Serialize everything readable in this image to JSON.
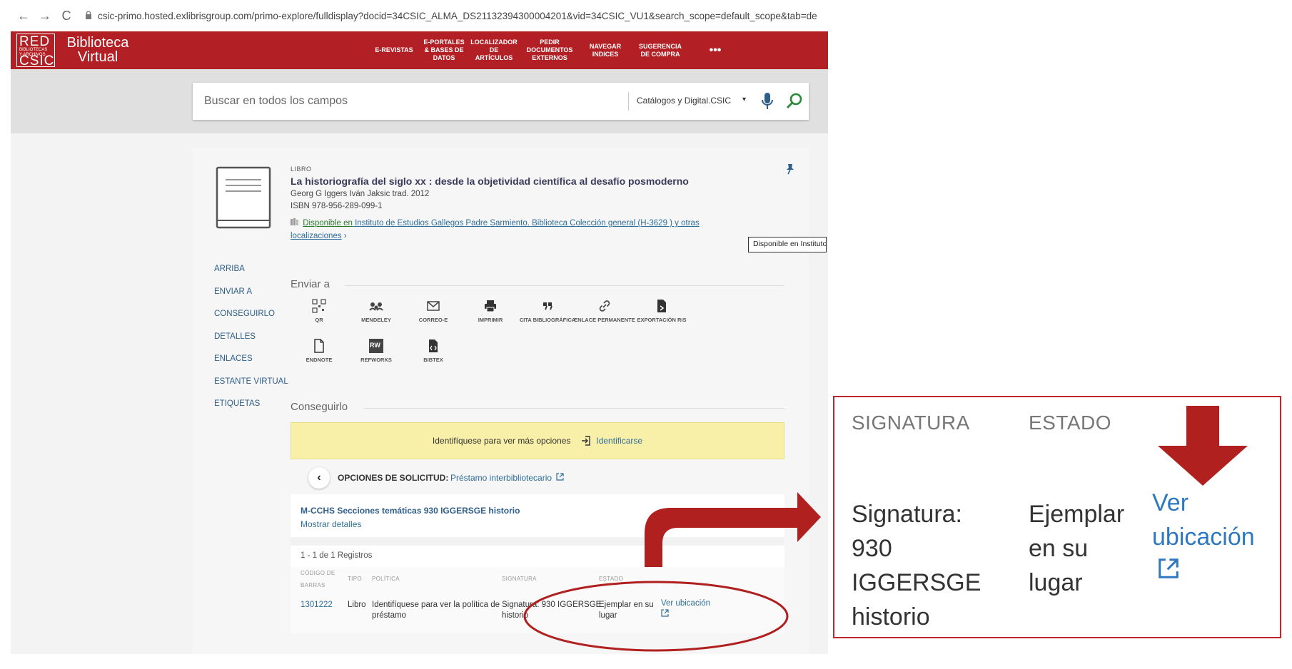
{
  "browser": {
    "back": "←",
    "forward": "→",
    "reload": "C",
    "url": "csic-primo.hosted.exlibrisgroup.com/primo-explore/fulldisplay?docid=34CSIC_ALMA_DS21132394300004201&vid=34CSIC_VU1&search_scope=default_scope&tab=de"
  },
  "header": {
    "logo_red": "RED",
    "logo_small_1": "BIBLIOTECAS",
    "logo_small_2": "Y ARCHIVOS",
    "logo_csic": "CSIC",
    "title_line1": "Biblioteca",
    "title_line2": "Virtual",
    "menu": [
      {
        "label": "E-REVISTAS"
      },
      {
        "label": "E-PORTALES & BASES DE DATOS"
      },
      {
        "label": "LOCALIZADOR DE ARTÍCULOS"
      },
      {
        "label": "PEDIR DOCUMENTOS EXTERNOS"
      },
      {
        "label": "NAVEGAR INDICES"
      },
      {
        "label": "SUGERENCIA DE COMPRA"
      }
    ],
    "more": "•••"
  },
  "search": {
    "placeholder": "Buscar en todos los campos",
    "scope": "Catálogos y Digital.CSIC",
    "scope_caret": "▾"
  },
  "record": {
    "type": "LIBRO",
    "title": "La historiografía del siglo xx : desde la objetividad científica al desafío posmoderno",
    "author": "Georg G Iggers Iván Jaksic trad. 2012",
    "isbn": "ISBN 978-956-289-099-1",
    "avail_status": "Disponible en",
    "avail_location": " Instituto de Estudios Gallegos Padre Sarmiento. Biblioteca  Colección general (H-3629 ) y otras",
    "avail_more": "localizaciones",
    "avail_chevron": " ›",
    "tooltip": "Disponible en Instituto"
  },
  "left_nav": [
    {
      "label": "ARRIBA"
    },
    {
      "label": "ENVIAR A"
    },
    {
      "label": "CONSEGUIRLO"
    },
    {
      "label": "DETALLES"
    },
    {
      "label": "ENLACES"
    },
    {
      "label": "ESTANTE VIRTUAL"
    },
    {
      "label": "ETIQUETAS"
    }
  ],
  "send_to": {
    "title": "Enviar a",
    "actions": [
      {
        "label": "QR",
        "icon": "qr-icon"
      },
      {
        "label": "MENDELEY",
        "icon": "mendeley-icon"
      },
      {
        "label": "CORREO-E",
        "icon": "email-icon"
      },
      {
        "label": "IMPRIMIR",
        "icon": "print-icon"
      },
      {
        "label": "CITA BIBLIOGRÁFICA",
        "icon": "quote-icon"
      },
      {
        "label": "ENLACE PERMANENTE",
        "icon": "link-icon"
      },
      {
        "label": "EXPORTACIÓN RIS",
        "icon": "file-export-icon"
      },
      {
        "label": "ENDNOTE",
        "icon": "file-icon"
      },
      {
        "label": "REFWORKS",
        "icon": "refworks-icon"
      },
      {
        "label": "BIBTEX",
        "icon": "file-code-icon"
      }
    ],
    "refworks_badge": "RW"
  },
  "get_it": {
    "title": "Conseguirlo",
    "login_text": "Identifíquese para ver más opciones",
    "login_link": "Identificarse",
    "request_label": "OPCIONES DE SOLICITUD:",
    "request_link": "Préstamo interbibliotecario",
    "location": "M-CCHS  Secciones temáticas  930 IGGERSGE historio",
    "details_link": "Mostrar detalles",
    "records": "1 - 1 de 1 Registros",
    "table": {
      "headers": {
        "barcode_1": "CÓDIGO DE",
        "barcode_2": "BARRAS",
        "type": "TIPO",
        "policy": "POLÍTICA",
        "signature": "SIGNATURA",
        "status": "ESTADO"
      },
      "row": {
        "barcode": "1301222",
        "type": "Libro",
        "policy_1": "Identifíquese para ver la política de",
        "policy_2": "préstamo",
        "signature_1": "Signatura: 930 IGGERSGE",
        "signature_2": "historio",
        "status_1": "Ejemplar en su",
        "status_2": "lugar",
        "location_link": "Ver ubicación"
      }
    }
  },
  "zoom": {
    "head_signature": "SIGNATURA",
    "head_status": "ESTADO",
    "sig_1": "Signatura:",
    "sig_2": "930",
    "sig_3": "IGGERSGE",
    "sig_4": "historio",
    "status_1": "Ejemplar",
    "status_2": "en su",
    "status_3": "lugar",
    "link_1": "Ver",
    "link_2": "ubicación"
  },
  "colors": {
    "brand_red": "#b21f24",
    "annotation_red": "#b0201f",
    "link_blue": "#2e6e9a"
  }
}
